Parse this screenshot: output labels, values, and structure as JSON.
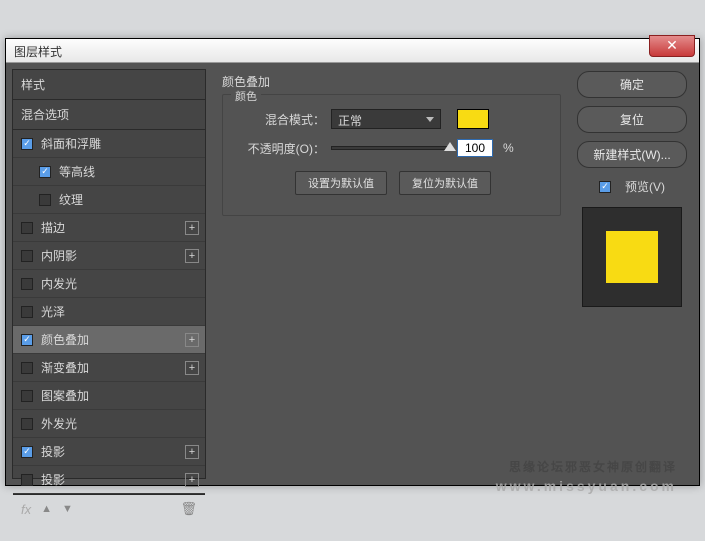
{
  "dialog": {
    "title": "图层样式"
  },
  "left": {
    "styles_header": "样式",
    "blend_header": "混合选项",
    "items": [
      {
        "label": "斜面和浮雕",
        "checked": true,
        "plus": false,
        "indent": false
      },
      {
        "label": "等高线",
        "checked": true,
        "plus": false,
        "indent": true
      },
      {
        "label": "纹理",
        "checked": false,
        "plus": false,
        "indent": true
      },
      {
        "label": "描边",
        "checked": false,
        "plus": true,
        "indent": false
      },
      {
        "label": "内阴影",
        "checked": false,
        "plus": true,
        "indent": false
      },
      {
        "label": "内发光",
        "checked": false,
        "plus": false,
        "indent": false
      },
      {
        "label": "光泽",
        "checked": false,
        "plus": false,
        "indent": false
      },
      {
        "label": "颜色叠加",
        "checked": true,
        "plus": true,
        "indent": false,
        "selected": true
      },
      {
        "label": "渐变叠加",
        "checked": false,
        "plus": true,
        "indent": false
      },
      {
        "label": "图案叠加",
        "checked": false,
        "plus": false,
        "indent": false
      },
      {
        "label": "外发光",
        "checked": false,
        "plus": false,
        "indent": false
      },
      {
        "label": "投影",
        "checked": true,
        "plus": true,
        "indent": false
      },
      {
        "label": "投影",
        "checked": false,
        "plus": true,
        "indent": false
      }
    ],
    "fx_label": "fx"
  },
  "center": {
    "section_title": "颜色叠加",
    "fieldset_legend": "颜色",
    "blend_mode_label": "混合模式：",
    "blend_mode_value": "正常",
    "opacity_label": "不透明度(O)：",
    "opacity_value": "100",
    "opacity_unit": "%",
    "set_default": "设置为默认值",
    "reset_default": "复位为默认值",
    "overlay_color": "#f8db13"
  },
  "right": {
    "ok": "确定",
    "cancel": "复位",
    "new_style": "新建样式(W)...",
    "preview_label": "预览(V)",
    "preview_checked": true,
    "preview_color": "#f8db13"
  },
  "watermark": {
    "line1": "思缘论坛邪恶女神原创翻译",
    "line2": "www.missyuan.com"
  },
  "chart_data": null
}
